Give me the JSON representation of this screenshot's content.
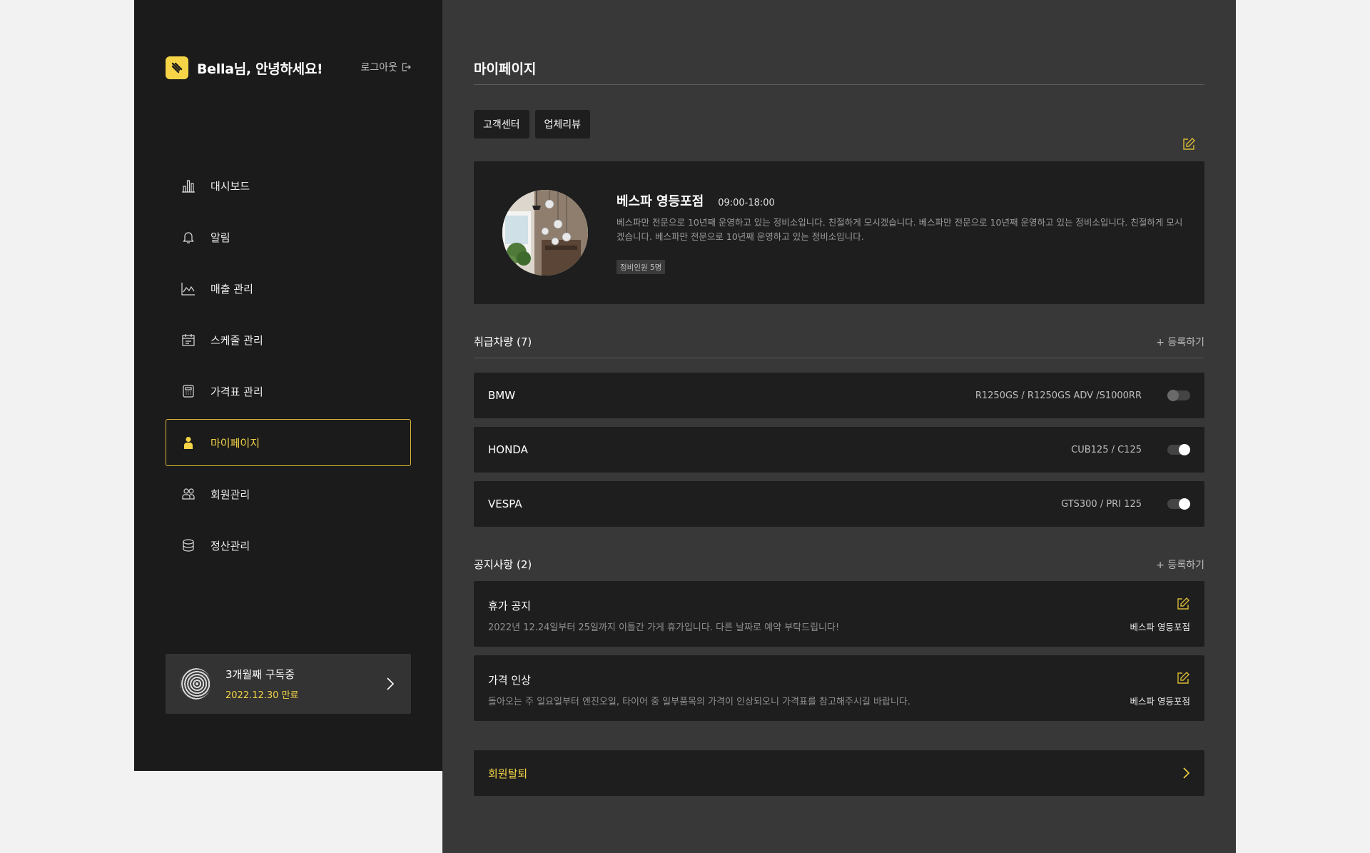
{
  "sidebar": {
    "greeting": "Bella님, 안녕하세요!",
    "logout": "로그아웃",
    "nav": [
      {
        "label": "대시보드",
        "icon": "bar-chart-icon"
      },
      {
        "label": "알림",
        "icon": "bell-icon"
      },
      {
        "label": "매출 관리",
        "icon": "line-chart-icon"
      },
      {
        "label": "스케줄 관리",
        "icon": "calendar-icon"
      },
      {
        "label": "가격표 관리",
        "icon": "calculator-icon"
      },
      {
        "label": "마이페이지",
        "icon": "person-icon",
        "active": true
      },
      {
        "label": "회원관리",
        "icon": "members-icon"
      },
      {
        "label": "정산관리",
        "icon": "database-icon"
      }
    ],
    "subscription": {
      "title": "3개월째 구독중",
      "expiry": "2022.12.30 만료"
    }
  },
  "main": {
    "page_title": "마이페이지",
    "tabs": [
      "고객센터",
      "업체리뷰"
    ],
    "shop": {
      "name": "베스파 영등포점",
      "hours": "09:00-18:00",
      "description": "베스파만 전문으로 10년째 운영하고 있는 정비소입니다.  친절하게 모시겠습니다. 베스파만 전문으로 10년째 운영하고 있는 정비소입니다.  친절하게 모시겠습니다. 베스파만 전문으로 10년째 운영하고 있는 정비소입니다.",
      "badge": "정비인원 5명"
    },
    "vehicles_section": {
      "title": "취급차량 (7)",
      "add": "+ 등록하기",
      "items": [
        {
          "brand": "BMW",
          "models": "R1250GS / R1250GS ADV /S1000RR",
          "enabled": false
        },
        {
          "brand": "HONDA",
          "models": "CUB125 / C125",
          "enabled": true
        },
        {
          "brand": "VESPA",
          "models": "GTS300 / PRI 125",
          "enabled": true
        }
      ]
    },
    "notices_section": {
      "title": "공지사항 (2)",
      "add": "+ 등록하기",
      "items": [
        {
          "title": "휴가 공지",
          "body": "2022년 12.24일부터 25일까지 이틀간 가게 휴가입니다. 다른 날짜로 예약 부탁드립니다!",
          "author": "베스파 영등포점"
        },
        {
          "title": "가격 인상",
          "body": "돌아오는 주 일요일부터 엔진오일, 타이어 중 일부품목의 가격이 인상되오니 가격표를 참고해주시길 바랍니다.",
          "author": "베스파 영등포점"
        }
      ]
    },
    "withdraw": "회원탈퇴"
  },
  "colors": {
    "accent": "#f5d547",
    "sidebar_bg": "#1b1b1b",
    "main_bg": "#383838",
    "card_bg": "#1e1e1e"
  }
}
